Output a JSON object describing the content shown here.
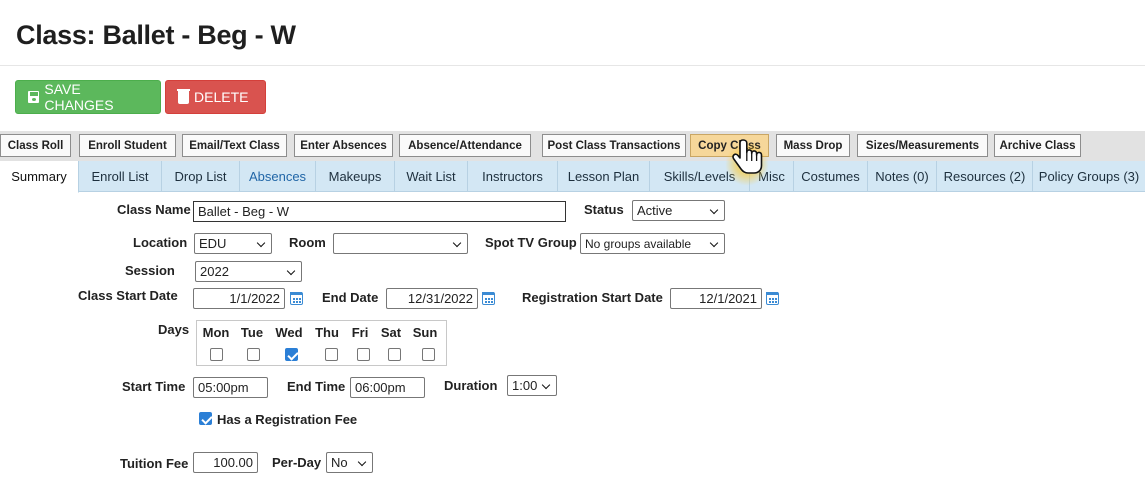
{
  "page": {
    "title": "Class: Ballet - Beg - W"
  },
  "toolbar": {
    "save_label": "SAVE CHANGES",
    "delete_label": "DELETE"
  },
  "actions": [
    "Class Roll",
    "Enroll Student",
    "Email/Text Class",
    "Enter Absences",
    "Absence/Attendance",
    "Post Class Transactions",
    "Copy Class",
    "Mass Drop",
    "Sizes/Measurements",
    "Archive Class"
  ],
  "tabs": [
    "Summary",
    "Enroll List",
    "Drop List",
    "Absences",
    "Makeups",
    "Wait List",
    "Instructors",
    "Lesson Plan",
    "Skills/Levels",
    "Misc",
    "Costumes",
    "Notes (0)",
    "Resources (2)",
    "Policy Groups (3)"
  ],
  "form": {
    "class_name_label": "Class Name",
    "class_name": "Ballet - Beg - W",
    "status_label": "Status",
    "status": "Active",
    "location_label": "Location",
    "location": "EDU",
    "room_label": "Room",
    "room": "",
    "spot_tv_label": "Spot TV Group",
    "spot_tv": "No groups available",
    "session_label": "Session",
    "session": "2022",
    "start_date_label": "Class Start Date",
    "start_date": "1/1/2022",
    "end_date_label": "End Date",
    "end_date": "12/31/2022",
    "reg_start_label": "Registration Start Date",
    "reg_start": "12/1/2021",
    "days_label": "Days",
    "days": [
      "Mon",
      "Tue",
      "Wed",
      "Thu",
      "Fri",
      "Sat",
      "Sun"
    ],
    "days_checked": [
      false,
      false,
      true,
      false,
      false,
      false,
      false
    ],
    "start_time_label": "Start Time",
    "start_time": "05:00pm",
    "end_time_label": "End Time",
    "end_time": "06:00pm",
    "duration_label": "Duration",
    "duration": "1:00",
    "reg_fee_label": "Has a Registration Fee",
    "reg_fee_checked": true,
    "tuition_label": "Tuition Fee",
    "tuition": "100.00",
    "per_day_label": "Per-Day",
    "per_day": "No"
  },
  "colors": {
    "save": "#5cb85c",
    "delete": "#d9534f",
    "highlight": "#f6d79a",
    "tab_bar": "#d3e7f4",
    "link": "#2166a7"
  },
  "icons": {
    "save": "floppy-disk-icon",
    "delete": "trash-icon",
    "calendar": "calendar-icon",
    "cursor": "hand-pointer-icon"
  }
}
